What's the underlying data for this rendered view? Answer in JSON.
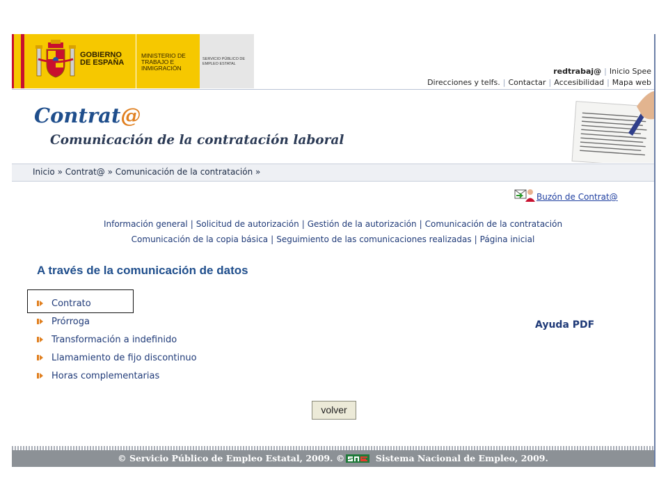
{
  "header": {
    "gov_name": "GOBIERNO DE ESPAÑA",
    "ministry": "MINISTERIO DE TRABAJO E INMIGRACIÓN",
    "service": "SERVICIO PÚBLICO DE EMPLEO ESTATAL",
    "top_links_row1": [
      "redtrabaj@",
      "Inicio Spee"
    ],
    "top_links_row2": [
      "Direcciones y telfs.",
      "Contactar",
      "Accesibilidad",
      "Mapa web"
    ]
  },
  "banner": {
    "title_main": "Contrat",
    "title_at": "@",
    "subtitle": "Comunicación de la contratación laboral"
  },
  "breadcrumb": {
    "items": [
      "Inicio",
      "Contrat@",
      "Comunicación de la contratación"
    ],
    "separator": "»"
  },
  "buzon": {
    "label": "Buzón de Contrat@"
  },
  "nav": {
    "row1": [
      "Información general",
      "Solicitud de autorización",
      "Gestión de la autorización",
      "Comunicación de la contratación"
    ],
    "row2": [
      "Comunicación de la copia básica",
      "Seguimiento de las comunicaciones realizadas",
      "Página inicial"
    ]
  },
  "section": {
    "heading": "A través de la comunicación de datos",
    "options": [
      "Contrato",
      "Prórroga",
      "Transformación a indefinido",
      "Llamamiento de fijo discontinuo",
      "Horas complementarias"
    ]
  },
  "help": {
    "label": "Ayuda PDF"
  },
  "actions": {
    "back_label": "volver"
  },
  "footer": {
    "text_left": "© Servicio Público de Empleo Estatal, 2009.",
    "text_copy": "©",
    "text_right": "Sistema Nacional de Empleo, 2009."
  },
  "colors": {
    "accent": "#1f4e8c",
    "at_sign": "#e07f1f",
    "gov_yellow": "#f6c800",
    "footer_bg": "#8c9196"
  }
}
